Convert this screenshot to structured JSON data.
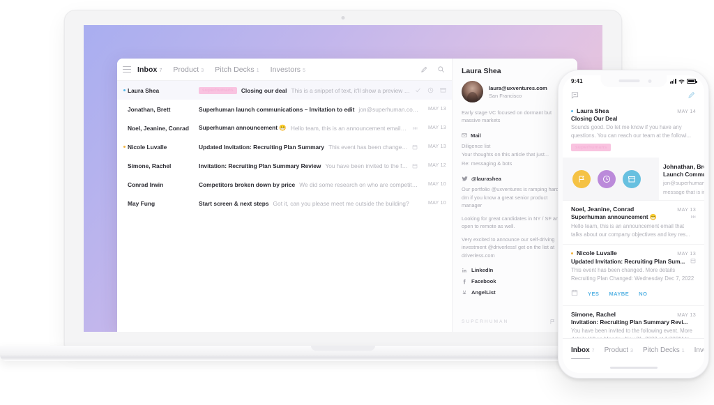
{
  "laptop": {
    "toolbar": {
      "menu_icon": "hamburger-icon",
      "compose_icon": "pencil-icon",
      "search_icon": "search-icon",
      "tabs": [
        {
          "label": "Inbox",
          "count": "7",
          "active": true
        },
        {
          "label": "Product",
          "count": "3",
          "active": false
        },
        {
          "label": "Pitch Decks",
          "count": "1",
          "active": false
        },
        {
          "label": "Investors",
          "count": "5",
          "active": false
        }
      ]
    },
    "rows": [
      {
        "dot": "blue",
        "sender": "Laura Shea",
        "tag": "superhumans",
        "subject": "Closing our deal",
        "snippet": "This is a snippet of text, it'll show a preview of content inside...",
        "date": "",
        "selected": true,
        "actions": [
          "check-icon",
          "clock-icon",
          "archive-icon"
        ]
      },
      {
        "dot": "none",
        "sender": "Jonathan, Brett",
        "tag": "",
        "subject": "Superhuman launch communications – Invitation to edit",
        "snippet": "jon@superhuman.com has invite...",
        "date": "MAY 13",
        "selected": false,
        "icon": ""
      },
      {
        "dot": "none",
        "sender": "Noel, Jeanine, Conrad",
        "tag": "",
        "subject": "Superhuman announcement 😁",
        "snippet": "Hello team, this is an announcement email that talks about t...",
        "date": "MAY 13",
        "selected": false,
        "icon": "attachment-icon"
      },
      {
        "dot": "amber",
        "sender": "Nicole Luvalle",
        "tag": "",
        "subject": "Updated Invitation: Recruiting Plan Summary",
        "snippet": "This event has been changed. More details Rec...",
        "date": "MAY 13",
        "selected": false,
        "icon": "calendar-icon"
      },
      {
        "dot": "none",
        "sender": "Simone, Rachel",
        "tag": "",
        "subject": "Invitation: Recruiting Plan Summary Review",
        "snippet": "You have been invited to the following event. Mo...",
        "date": "MAY 12",
        "selected": false,
        "icon": "calendar-icon"
      },
      {
        "dot": "none",
        "sender": "Conrad Irwin",
        "tag": "",
        "subject": "Competitors broken down by price",
        "snippet": "We did some research on who are competitors are and...",
        "date": "MAY 10",
        "selected": false,
        "icon": ""
      },
      {
        "dot": "none",
        "sender": "May Fung",
        "tag": "",
        "subject": "Start screen & next steps",
        "snippet": "Got it, can you please meet me outside the building?",
        "date": "MAY 10",
        "selected": false,
        "icon": ""
      }
    ],
    "sidebar": {
      "header": "Laura Shea",
      "avatar": "contact-avatar",
      "email": "laura@uxventures.com",
      "city": "San Francisco",
      "bio": "Early stage VC focused on dormant but massive markets",
      "mail_section": {
        "icon": "envelope-icon",
        "label": "Mail",
        "threads": [
          "Diligence list",
          "Your thoughts on this article that just...",
          "Re: messaging & bots"
        ]
      },
      "twitter_section": {
        "icon": "twitter-icon",
        "handle": "@laurashea",
        "tweets": [
          "Our portfolio @uxventures is ramping hard – dm if you know a great senior product manager",
          "Looking for great candidates in NY / SF and open to remote as well.",
          "Very excited to announce our self-driving investment @driverless! get on the list at driverless.com"
        ]
      },
      "socials": [
        {
          "icon": "linkedin-icon",
          "label": "LinkedIn"
        },
        {
          "icon": "facebook-icon",
          "label": "Facebook"
        },
        {
          "icon": "angellist-icon",
          "label": "AngelList"
        }
      ],
      "footer": {
        "wordmark": "SUPERHUMAN",
        "icons": [
          "flag-icon",
          "calendar-icon"
        ]
      }
    }
  },
  "phone": {
    "status": {
      "time": "9:41",
      "signal_icon": "cellular-bars-icon",
      "wifi_icon": "wifi-icon",
      "battery_icon": "battery-icon"
    },
    "toolbar": {
      "inbox_icon": "message-icon",
      "compose_icon": "pencil-icon"
    },
    "rows": [
      {
        "dot": "blue",
        "sender": "Laura Shea",
        "date": "MAY 14",
        "subject": "Closing Our Deal",
        "snippet": "Sounds good. Do let me know if you have any questions. You can reach our team at the followi...",
        "tag": "superhumans"
      },
      {
        "dot": "none",
        "sender": "Noel, Jeanine, Conrad",
        "date": "MAY 13",
        "subject": "Superhuman announcement 😁",
        "snippet": "Hello team, this is an announcement email that talks about our company objectives and key res...",
        "icon": "attachment-icon"
      },
      {
        "dot": "amber",
        "sender": "Nicole Luvalle",
        "date": "MAY 13",
        "subject": "Updated Invitation: Recruiting Plan Sum...",
        "snippet": "This event has been changed. More details Recruiting Plan Changed: Wednesday Dec 7, 2022",
        "icon": "calendar-icon",
        "rsvp": [
          "YES",
          "MAYBE",
          "NO"
        ]
      },
      {
        "dot": "none",
        "sender": "Simone, Rachel",
        "date": "MAY 13",
        "subject": "Invitation: Recruiting Plan Summary Revi...",
        "snippet": "You have been invited to the following event. More details When Monday Nov 21, 2022 at 1:30PM to..."
      }
    ],
    "swipe_row": {
      "actions": [
        {
          "icon": "flag-icon",
          "color": "#f5c244"
        },
        {
          "icon": "clock-icon",
          "color": "#bb8ada"
        },
        {
          "icon": "archive-icon",
          "color": "#67c0e0"
        }
      ],
      "peek": {
        "sender": "Johnathan, Brett",
        "subject": "Launch Communicat",
        "line1": "jon@superhuman.co",
        "line2": "message that is insi"
      }
    },
    "tabs": [
      {
        "label": "Inbox",
        "count": "7",
        "active": true
      },
      {
        "label": "Product",
        "count": "3",
        "active": false
      },
      {
        "label": "Pitch Decks",
        "count": "1",
        "active": false
      },
      {
        "label": "Inve",
        "count": "",
        "active": false
      }
    ]
  },
  "colors": {
    "accent_pink": "#f9c3e0",
    "accent_blue": "#5ab4e4",
    "dot_blue": "#55b8e8",
    "dot_amber": "#f2b33d",
    "swipe_yellow": "#f5c244",
    "swipe_purple": "#bb8ada",
    "swipe_blue": "#67c0e0",
    "gradient_start": "#a9aef0",
    "gradient_end": "#f0c3cc"
  }
}
